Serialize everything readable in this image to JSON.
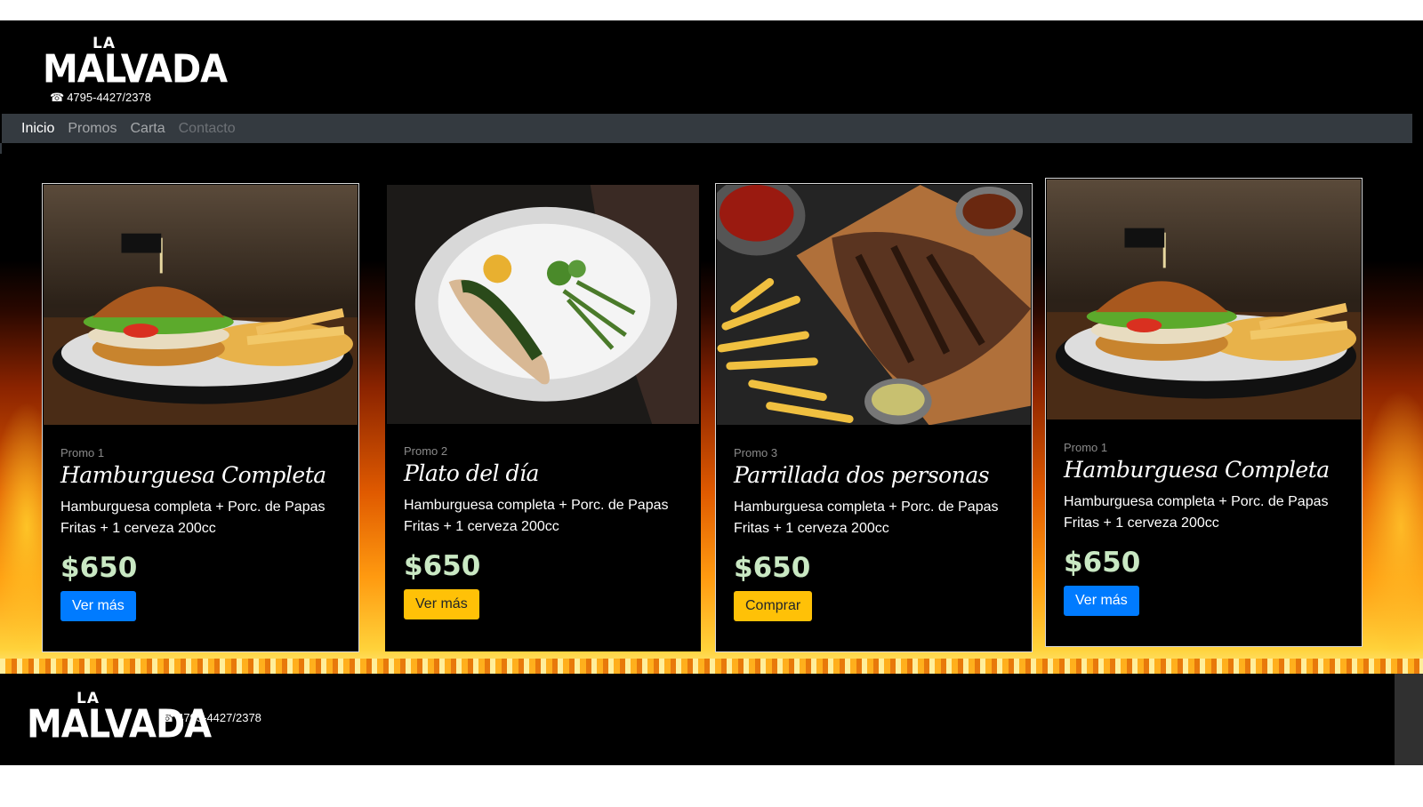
{
  "brand": {
    "logo_small": "LA",
    "logo_big": "MALVADA",
    "phone": "4795-4427/2378"
  },
  "nav": {
    "items": [
      {
        "label": "Inicio",
        "state": "active"
      },
      {
        "label": "Promos",
        "state": "normal"
      },
      {
        "label": "Carta",
        "state": "normal"
      },
      {
        "label": "Contacto",
        "state": "disabled"
      }
    ]
  },
  "cards": [
    {
      "promo": "Promo 1",
      "title": "Hamburguesa Completa",
      "description": "Hamburguesa completa + Porc. de Papas Fritas + 1 cerveza 200cc",
      "price": "$650",
      "button": "Ver más",
      "button_color": "#007bff",
      "image": "burger-photo"
    },
    {
      "promo": "Promo 2",
      "title": "Plato del día",
      "description": "Hamburguesa completa + Porc. de Papas Fritas + 1 cerveza 200cc",
      "price": "$650",
      "button": "Ver más",
      "button_color": "#ffc107",
      "image": "fish-plate-photo"
    },
    {
      "promo": "Promo 3",
      "title": "Parrillada dos personas",
      "description": "Hamburguesa completa + Porc. de Papas Fritas + 1 cerveza 200cc",
      "price": "$650",
      "button": "Comprar",
      "button_color": "#ffc107",
      "image": "grill-photo"
    },
    {
      "promo": "Promo 1",
      "title": "Hamburguesa Completa",
      "description": "Hamburguesa completa + Porc. de Papas Fritas + 1 cerveza 200cc",
      "price": "$650",
      "button": "Ver más",
      "button_color": "#007bff",
      "image": "burger-photo"
    }
  ],
  "footer": {
    "logo_small": "LA",
    "logo_big": "MALVADA",
    "phone": "4795-4427/2378"
  },
  "colors": {
    "nav_bg": "#343a40",
    "price": "#c9e8c3",
    "primary": "#007bff",
    "warning": "#ffc107"
  }
}
